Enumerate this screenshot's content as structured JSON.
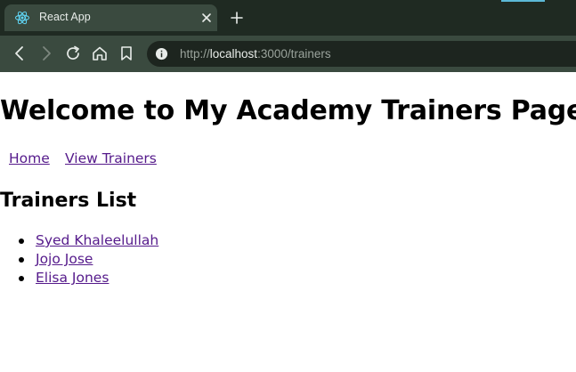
{
  "browser": {
    "tab": {
      "title": "React App",
      "favicon": "react-atom-icon"
    },
    "address_bar": {
      "url_prefix": "http://",
      "url_host": "localhost",
      "url_rest": ":3000/trainers"
    }
  },
  "page": {
    "title": "Welcome to My Academy Trainers Page",
    "nav": [
      {
        "label": "Home"
      },
      {
        "label": "View Trainers"
      }
    ],
    "section_title": "Trainers List",
    "trainers": [
      {
        "name": "Syed Khaleelullah"
      },
      {
        "name": "Jojo Jose"
      },
      {
        "name": "Elisa Jones"
      }
    ]
  },
  "colors": {
    "tabbar_bg": "#1f2a22",
    "toolbar_bg": "#3a4a3f",
    "visited_link": "#551a8b"
  }
}
